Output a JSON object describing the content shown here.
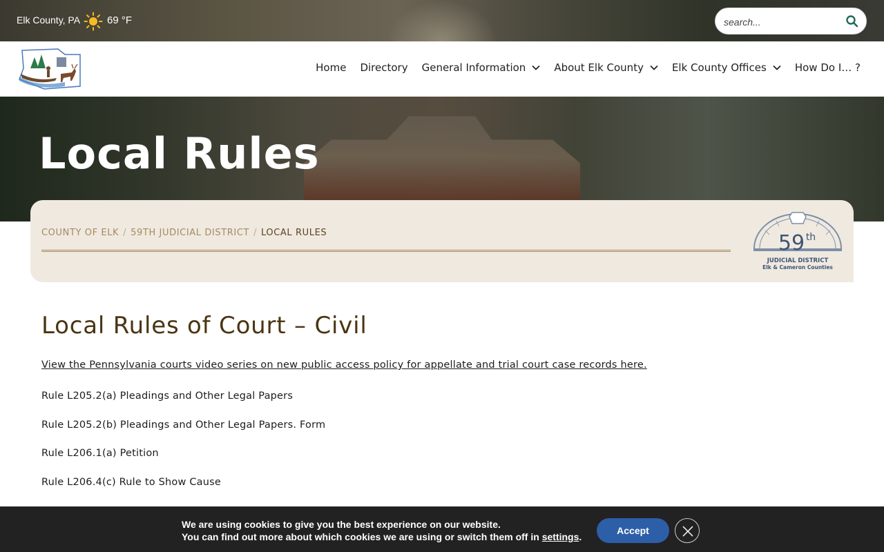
{
  "topbar": {
    "location": "Elk County, PA",
    "weather_icon": "sun-icon",
    "temperature": "69 °F",
    "search_placeholder": "search..."
  },
  "nav": {
    "items": [
      {
        "label": "Home",
        "has_dropdown": false
      },
      {
        "label": "Directory",
        "has_dropdown": false
      },
      {
        "label": "General Information",
        "has_dropdown": true
      },
      {
        "label": "About Elk County",
        "has_dropdown": true
      },
      {
        "label": "Elk County Offices",
        "has_dropdown": true
      },
      {
        "label": "How Do I… ?",
        "has_dropdown": false
      }
    ]
  },
  "hero": {
    "title": "Local Rules"
  },
  "breadcrumb": {
    "items": [
      "COUNTY OF ELK",
      "59TH JUDICIAL DISTRICT",
      "LOCAL RULES"
    ],
    "separator": "/"
  },
  "seal": {
    "number": "59",
    "suffix": "th",
    "line1": "JUDICIAL DISTRICT",
    "line2": "Elk & Cameron Counties"
  },
  "content": {
    "heading": "Local Rules of Court – Civil",
    "link_text": "View the Pennsylvania courts video series on new public access policy for appellate and trial court case records here.",
    "rules": [
      "Rule L205.2(a) Pleadings and Other Legal Papers",
      "Rule L205.2(b) Pleadings and Other Legal Papers. Form",
      "Rule L206.1(a) Petition",
      "Rule L206.4(c) Rule to Show Cause"
    ]
  },
  "cookie": {
    "line1": "We are using cookies to give you the best experience on our website.",
    "line2_prefix": "You can find out more about which cookies we are using or switch them off in ",
    "line2_link": "settings",
    "line2_suffix": ".",
    "accept_label": "Accept"
  },
  "colors": {
    "accent_brown": "#4a3512",
    "crumb_tan": "#a68a5e",
    "card_bg": "#efe9e0",
    "accept_blue": "#2d5ea8",
    "search_icon_green": "#1f6b5a"
  }
}
